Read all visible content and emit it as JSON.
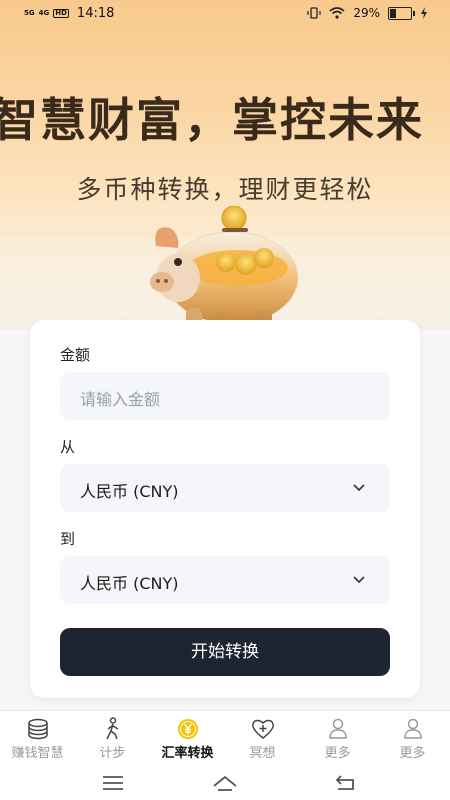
{
  "status": {
    "net1": "5G",
    "net2": "4G",
    "hd": "HD",
    "time": "14:18",
    "battery": "29%",
    "battery_level": 0.29
  },
  "hero": {
    "headline": "智慧财富，掌控未来",
    "subline": "多币种转换，理财更轻松"
  },
  "form": {
    "amount_label": "金额",
    "amount_placeholder": "请输入金额",
    "from_label": "从",
    "from_value": "人民币 (CNY)",
    "to_label": "到",
    "to_value": "人民币 (CNY)",
    "submit_label": "开始转换"
  },
  "tabs": [
    {
      "label": "赚钱智慧",
      "icon": "coins-icon",
      "active": false
    },
    {
      "label": "计步",
      "icon": "walking-icon",
      "active": false
    },
    {
      "label": "汇率转换",
      "icon": "yen-coin-icon",
      "active": true
    },
    {
      "label": "冥想",
      "icon": "heart-plus-icon",
      "active": false
    },
    {
      "label": "更多",
      "icon": "person-icon",
      "active": false
    },
    {
      "label": "更多",
      "icon": "person-icon",
      "active": false
    }
  ],
  "colors": {
    "accent_dark": "#1d2533",
    "active_tab_icon": "#f5c400",
    "hero_bg": "#f8c98c"
  }
}
